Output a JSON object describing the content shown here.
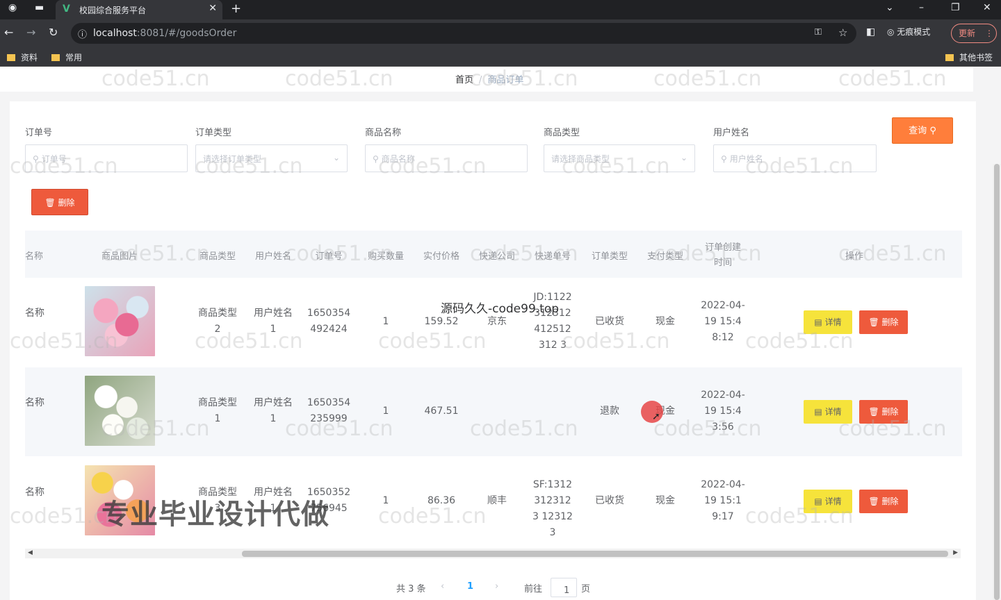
{
  "browser": {
    "tab_title": "校园综合服务平台",
    "tab_close": "✕",
    "new_tab": "+",
    "url_host": "localhost",
    "url_rest": ":8081/#/goodsOrder",
    "incognito_label": "无痕模式",
    "update_label": "更新",
    "bookmarks": [
      "资料",
      "常用"
    ],
    "other_bookmarks": "其他书签"
  },
  "breadcrumb": {
    "home": "首页",
    "separator": "/",
    "current": "商品订单"
  },
  "filters": {
    "order_no": {
      "label": "订单号",
      "placeholder": "订单号"
    },
    "order_type": {
      "label": "订单类型",
      "placeholder": "请选择订单类型"
    },
    "goods_name": {
      "label": "商品名称",
      "placeholder": "商品名称"
    },
    "goods_type": {
      "label": "商品类型",
      "placeholder": "请选择商品类型"
    },
    "user_name": {
      "label": "用户姓名",
      "placeholder": "用户姓名"
    },
    "query_label": "查询"
  },
  "delete_label": "删除",
  "table": {
    "headers": [
      "名称",
      "商品图片",
      "商品类型",
      "用户姓名",
      "订单号",
      "购买数量",
      "实付价格",
      "快递公司",
      "快递单号",
      "订单类型",
      "支付类型",
      "订单创建时间",
      "操作"
    ],
    "rows": [
      {
        "name": "名称",
        "goods_type": "商品类型2",
        "user_name": "用户姓名1",
        "order_no": "1650354492424",
        "qty": "1",
        "price": "159.52",
        "courier": "京东",
        "tracking": "JD:1122312312412512312 3",
        "order_type": "已收货",
        "pay_type": "现金",
        "created": "2022-04-19 15:48:12"
      },
      {
        "name": "名称",
        "goods_type": "商品类型1",
        "user_name": "用户姓名1",
        "order_no": "1650354235999",
        "qty": "1",
        "price": "467.51",
        "courier": "",
        "tracking": "",
        "order_type": "退款",
        "pay_type": "现金",
        "created": "2022-04-19 15:43:56"
      },
      {
        "name": "名称",
        "goods_type": "商品类型3",
        "user_name": "用户姓名1",
        "order_no": "1650352756945",
        "qty": "1",
        "price": "86.36",
        "courier": "顺丰",
        "tracking": "SF:1312 3123123 123123",
        "order_type": "已收货",
        "pay_type": "现金",
        "created": "2022-04-19 15:19:17"
      }
    ],
    "detail_label": "详情",
    "delete_label": "删除"
  },
  "pagination": {
    "total": "共 3 条",
    "current_page": "1",
    "goto": "前往",
    "page_input": "1",
    "page_suffix": "页"
  },
  "watermarks": {
    "site": "code51.cn",
    "center": "源码久久-code99.top",
    "promo": "专业毕业设计代做"
  }
}
